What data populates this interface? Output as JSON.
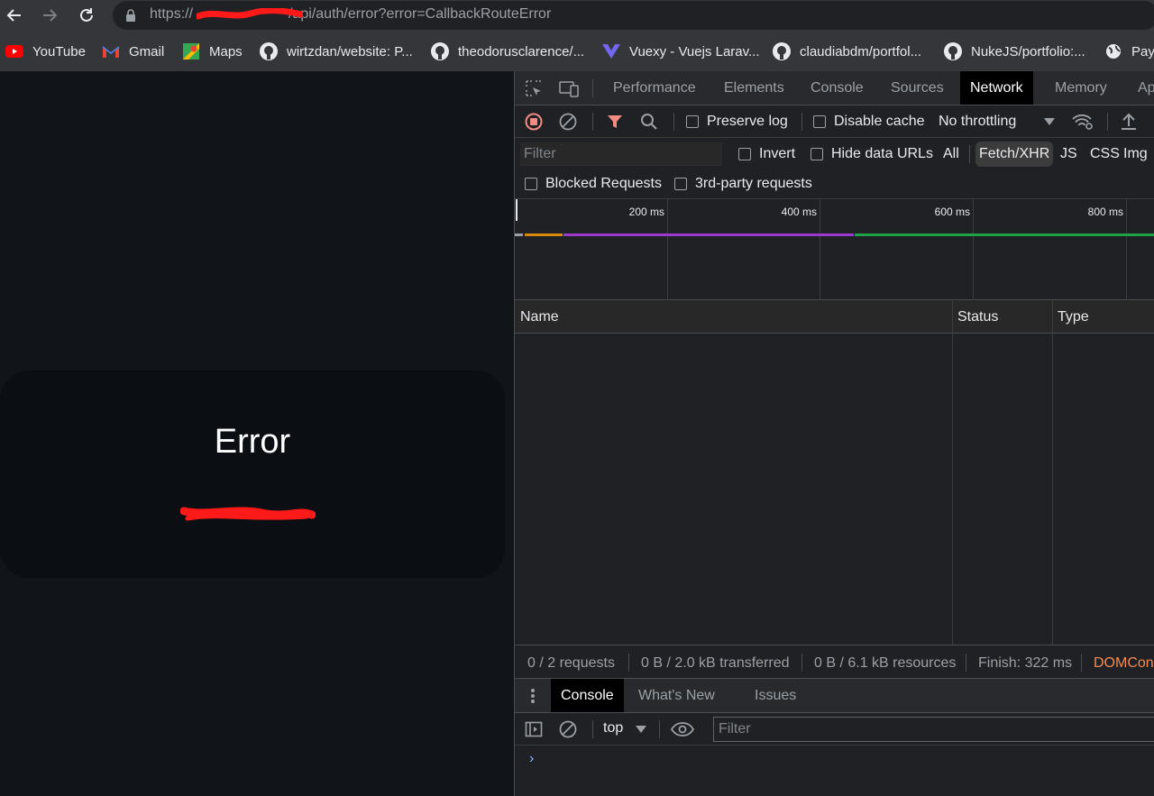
{
  "browser": {
    "url_prefix": "https://",
    "url_path": "/api/auth/error?error=CallbackRouteError",
    "bookmarks": [
      {
        "label": "YouTube",
        "icon": "youtube-icon"
      },
      {
        "label": "Gmail",
        "icon": "gmail-icon"
      },
      {
        "label": "Maps",
        "icon": "maps-icon"
      },
      {
        "label": "wirtzdan/website: P...",
        "icon": "github-icon"
      },
      {
        "label": "theodorusclarence/...",
        "icon": "github-icon"
      },
      {
        "label": "Vuexy - Vuejs Larav...",
        "icon": "vuexy-icon"
      },
      {
        "label": "claudiabdm/portfol...",
        "icon": "github-icon"
      },
      {
        "label": "NukeJS/portfolio:...",
        "icon": "github-icon"
      },
      {
        "label": "Pay",
        "icon": "globe-icon"
      }
    ]
  },
  "page": {
    "error_title": "Error"
  },
  "devtools": {
    "tabs": [
      "Performance",
      "Elements",
      "Console",
      "Sources",
      "Network",
      "Memory",
      "Ap"
    ],
    "active_tab": "Network",
    "toolbar": {
      "preserve_log": "Preserve log",
      "disable_cache": "Disable cache",
      "throttling": "No throttling"
    },
    "filter": {
      "placeholder": "Filter",
      "invert": "Invert",
      "hide_data_urls": "Hide data URLs",
      "types": [
        "All",
        "Fetch/XHR",
        "JS",
        "CSS",
        "Img"
      ],
      "active_type": "Fetch/XHR",
      "blocked_requests": "Blocked Requests",
      "third_party": "3rd-party requests"
    },
    "timeline": {
      "ticks": [
        "200 ms",
        "400 ms",
        "600 ms",
        "800 ms"
      ],
      "colors": {
        "orange": "#d98a0b",
        "purple": "#9c3ad0",
        "green": "#1ea446",
        "gray": "#9aa0a6"
      }
    },
    "columns": [
      "Name",
      "Status",
      "Type"
    ],
    "summary": {
      "requests": "0 / 2 requests",
      "transferred": "0 B / 2.0 kB transferred",
      "resources": "0 B / 6.1 kB resources",
      "finish": "Finish: 322 ms",
      "dom": "DOMCon"
    },
    "drawer": {
      "tabs": [
        "Console",
        "What's New",
        "Issues"
      ],
      "active_tab": "Console",
      "context": "top",
      "filter_placeholder": "Filter",
      "prompt": "›"
    }
  }
}
